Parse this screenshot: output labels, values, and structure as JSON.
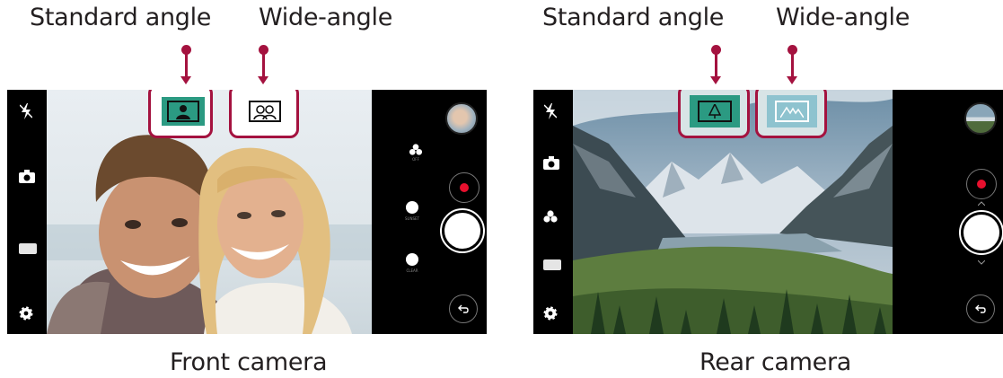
{
  "front": {
    "standard_label": "Standard angle",
    "wide_label": "Wide-angle",
    "caption": "Front camera",
    "side_labels": [
      "OFF",
      "SUNSET",
      "CLEAR"
    ]
  },
  "rear": {
    "standard_label": "Standard angle",
    "wide_label": "Wide-angle",
    "caption": "Rear camera"
  },
  "colors": {
    "highlight": "#a4123f",
    "selected_mode": "#2b9a82",
    "wide_mode_rear": "#8ec3cf",
    "record": "#e8102e"
  },
  "icons": [
    "flash-off-icon",
    "switch-camera-icon",
    "filter-icon",
    "gallery-strip-icon",
    "settings-icon",
    "record-icon",
    "shutter-icon",
    "back-icon",
    "portrait-icon",
    "group-icon",
    "tree-icon",
    "mountains-icon"
  ]
}
